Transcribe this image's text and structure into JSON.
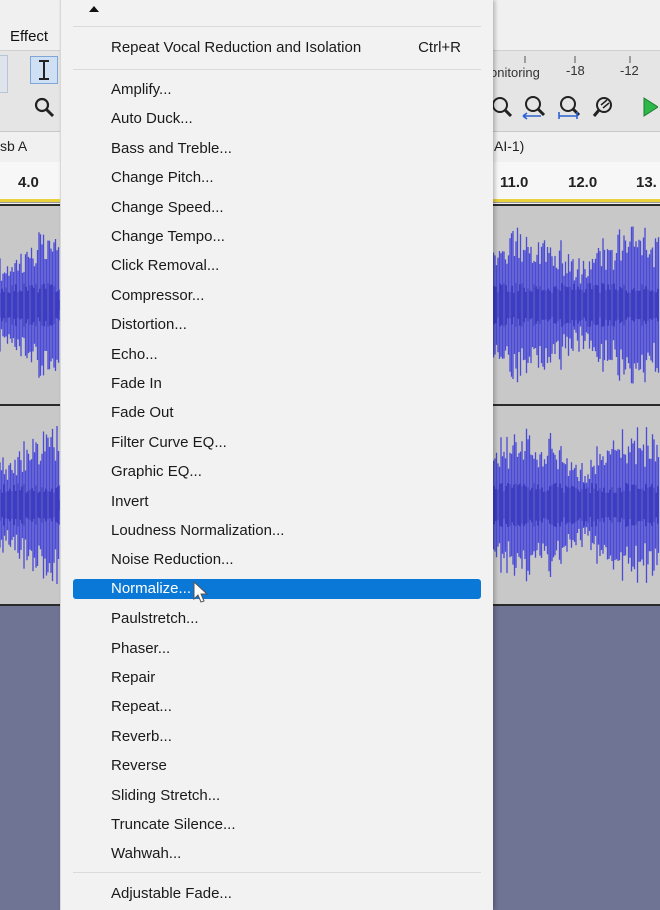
{
  "menubar": {
    "effect_label": "Effect"
  },
  "toolbar": {
    "meter_label": "onitoring",
    "meter_ticks": [
      "-18",
      "-12"
    ]
  },
  "device_bar": {
    "left_text": "sb A",
    "right_text": "AI-1)"
  },
  "ruler": {
    "ticks": [
      "4.0",
      "11.0",
      "12.0",
      "13."
    ]
  },
  "effect_menu": {
    "repeat_item": {
      "label": "Repeat Vocal Reduction and Isolation",
      "shortcut": "Ctrl+R"
    },
    "items": [
      "Amplify...",
      "Auto Duck...",
      "Bass and Treble...",
      "Change Pitch...",
      "Change Speed...",
      "Change Tempo...",
      "Click Removal...",
      "Compressor...",
      "Distortion...",
      "Echo...",
      "Fade In",
      "Fade Out",
      "Filter Curve EQ...",
      "Graphic EQ...",
      "Invert",
      "Loudness Normalization...",
      "Noise Reduction...",
      "Normalize...",
      "Paulstretch...",
      "Phaser...",
      "Repair",
      "Repeat...",
      "Reverb...",
      "Reverse",
      "Sliding Stretch...",
      "Truncate Silence...",
      "Wahwah..."
    ],
    "highlighted_index": 17,
    "bottom_item": "Adjustable Fade..."
  },
  "colors": {
    "highlight": "#0a78d7",
    "waveform": "#4b4bd6",
    "track_bg": "#c8c8c8",
    "empty_area": "#6f7394"
  },
  "icons": [
    "select-tool-icon",
    "zoom-tool-icon",
    "zoom-in-icon",
    "zoom-out-icon",
    "fit-selection-icon",
    "zoom-toggle-icon",
    "play-icon",
    "mouse-pointer-icon"
  ]
}
